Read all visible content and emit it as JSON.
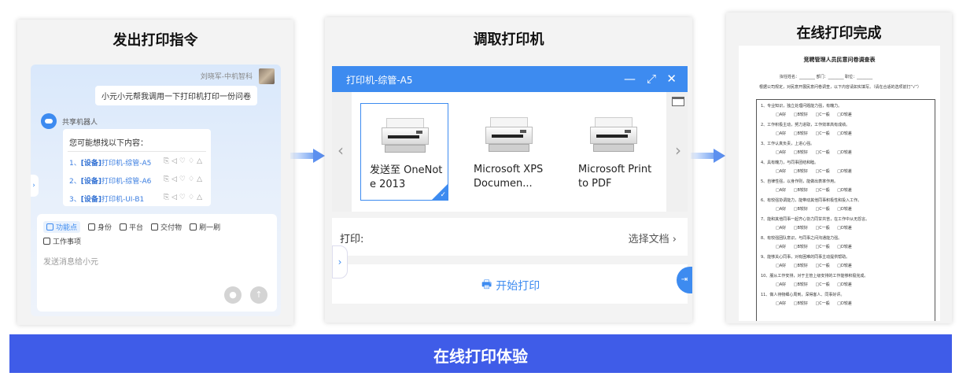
{
  "panel1": {
    "title": "发出打印指令",
    "user_name": "刘晓军-中机智科",
    "user_message": "小元小元帮我调用一下打印机打印一份问卷",
    "bot_name": "共享机器人",
    "bot_question": "您可能想找以下内容：",
    "options": [
      {
        "prefix": "1、",
        "tag": "[设备]",
        "text": "打印机-综管-A5"
      },
      {
        "prefix": "2、",
        "tag": "[设备]",
        "text": "打印机-综管-A6"
      },
      {
        "prefix": "3、",
        "tag": "[设备]",
        "text": "打印机-UI-B1"
      }
    ],
    "tools": [
      "功能点",
      "身份",
      "平台",
      "交付物",
      "刷一刷"
    ],
    "tools_row2": [
      "工作事项"
    ],
    "compose_placeholder": "发送消息给小元"
  },
  "panel2": {
    "title": "调取打印机",
    "window_title": "打印机-综管-A5",
    "printers": [
      {
        "label": "发送至 OneNote 2013",
        "selected": true
      },
      {
        "label": "Microsoft XPS Documen...",
        "selected": false
      },
      {
        "label": "Microsoft Print to PDF",
        "selected": false
      }
    ],
    "print_label": "打印:",
    "print_value": "选择文档",
    "start_label": "开始打印"
  },
  "panel3": {
    "title": "在线打印完成",
    "doc_title": "竞聘管理人员民意问卷调查表",
    "doc_meta": "拟任姓名：________    部门：________    职位：________",
    "doc_intro": "根据公司规定，对民意开展民意问卷调查，以下内容请如实填写。（请在合适的选项前打“√”）",
    "questions": [
      "1、专业知识，独立处理问题能力强，有魄力。",
      "2、工作积极主动，努力进取，工作效率高有成绩。",
      "3、工作认真负责，上进心强。",
      "4、具有魄力，与同事团结和睦。",
      "5、自律性强，以身作则，能做出表率作用。",
      "6、有较强协调能力，能带动其他同事积极性和投入工作。",
      "7、能和其他同事一起齐心协力同甘共苦，在工作中从无怨言。",
      "8、有较强团队意识，与同事之间沟通能力强。",
      "9、能够关心同事，对有困难的同事主动提供帮助。",
      "10、服从工作安排，对于主管上级安排的工作能够积极完成。",
      "11、做人待物细心周到，深得客人、同事好评。"
    ],
    "options_line": "□A好 □B较好 □C一般 □D较差"
  },
  "banner": {
    "text": "在线打印体验"
  },
  "colors": {
    "accent": "#3d8bf0",
    "banner": "#3f5ce8"
  }
}
